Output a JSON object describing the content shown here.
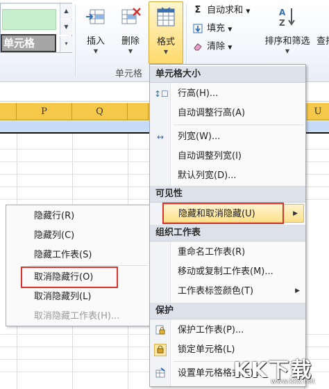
{
  "ribbon": {
    "style_cell_label": "单元格",
    "insert_label": "插入",
    "delete_label": "删除",
    "format_label": "格式",
    "group_cells_label": "单元格",
    "autosum_label": "自动求和",
    "fill_label": "填充",
    "clear_label": "清除",
    "sort_filter_label": "排序和筛选",
    "find_label": "查找"
  },
  "columns": [
    "P",
    "Q",
    "U"
  ],
  "format_menu": {
    "section_cell_size": "单元格大小",
    "row_height": "行高(H)...",
    "autofit_row_height": "自动调整行高(A)",
    "column_width": "列宽(W)...",
    "autofit_column_width": "自动调整列宽(I)",
    "default_width": "默认列宽(D)...",
    "section_visibility": "可见性",
    "hide_unhide": "隐藏和取消隐藏(U)",
    "section_organize_sheets": "组织工作表",
    "rename_sheet": "重命名工作表(R)",
    "move_copy_sheet": "移动或复制工作表(M)...",
    "tab_color": "工作表标签颜色(T)",
    "section_protection": "保护",
    "protect_sheet": "保护工作表(P)...",
    "lock_cell": "锁定单元格(L)",
    "format_cells": "设置单元格格式(E)..."
  },
  "hide_submenu": {
    "hide_rows": "隐藏行(R)",
    "hide_columns": "隐藏列(C)",
    "hide_sheet": "隐藏工作表(S)",
    "unhide_rows": "取消隐藏行(O)",
    "unhide_columns": "取消隐藏列(L)",
    "unhide_sheet": "取消隐藏工作表(H)..."
  },
  "watermark": {
    "brand": "KK下载",
    "url": "www.kkx.net"
  },
  "colors": {
    "column_header": "#f6c84a",
    "selected_row": "#c6dcf6",
    "highlight": "#fde18b",
    "annotation_red": "#d9342b"
  }
}
